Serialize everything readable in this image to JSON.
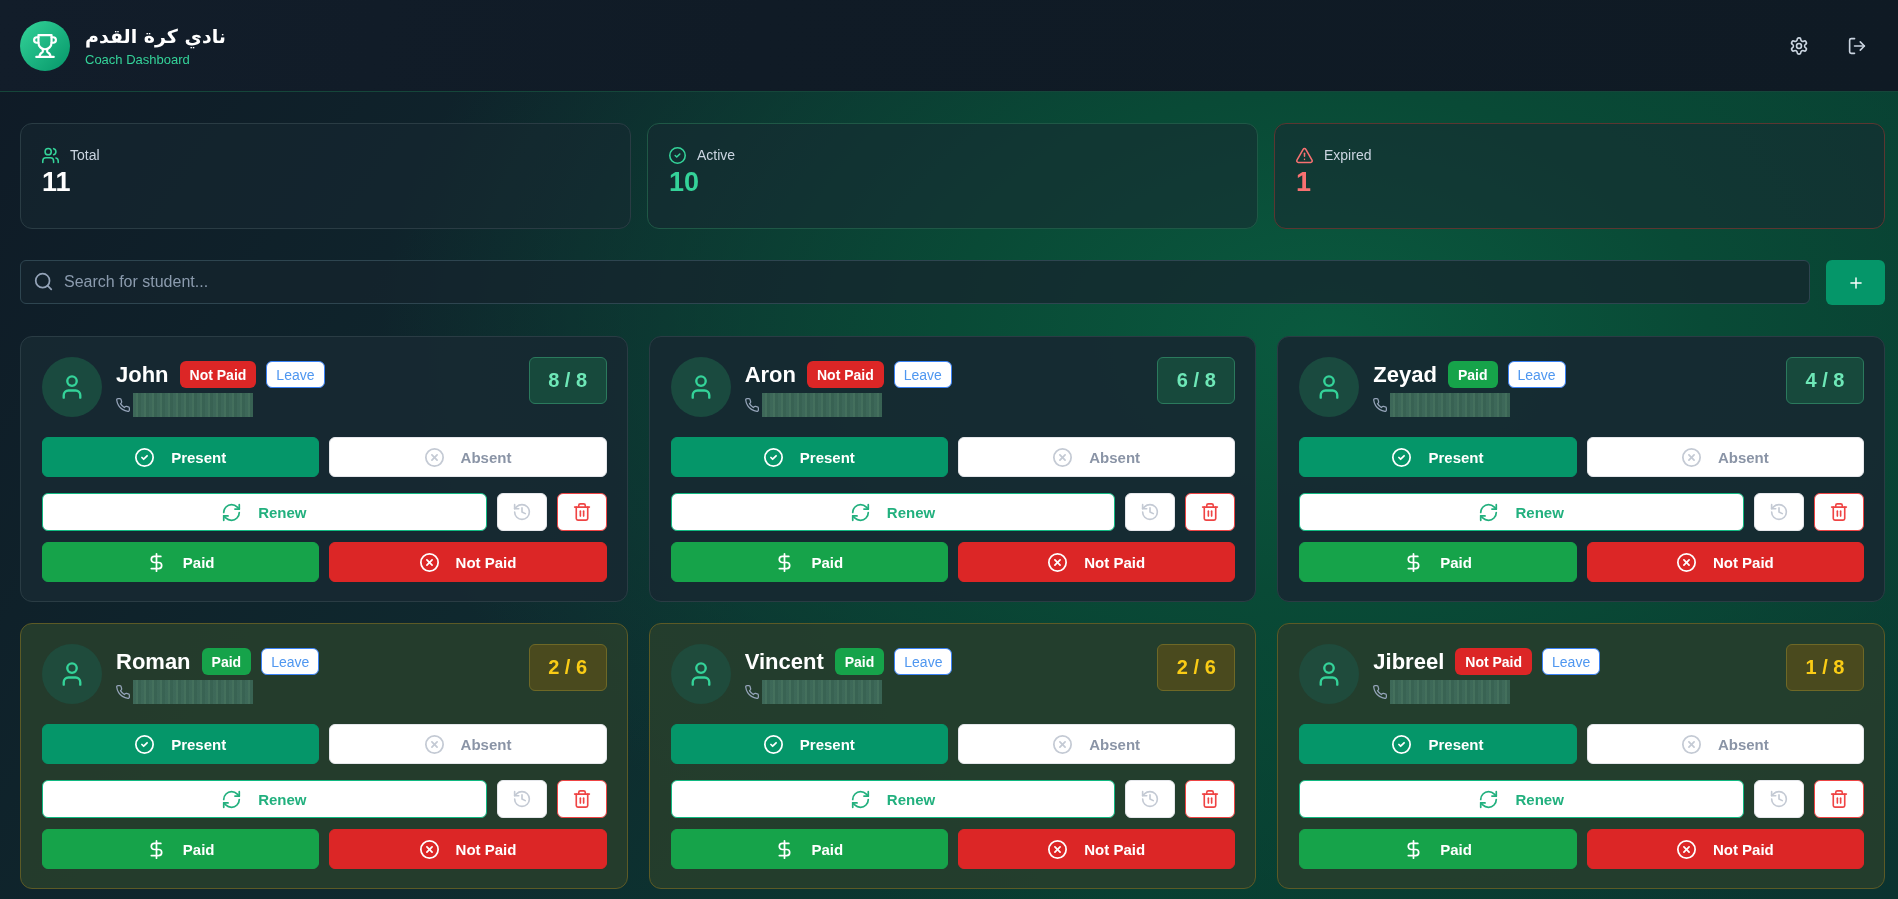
{
  "header": {
    "title": "نادي كرة القدم",
    "subtitle": "Coach Dashboard"
  },
  "stats": [
    {
      "kind": "total",
      "label": "Total",
      "value": "11"
    },
    {
      "kind": "active",
      "label": "Active",
      "value": "10"
    },
    {
      "kind": "expired",
      "label": "Expired",
      "value": "1"
    }
  ],
  "search": {
    "placeholder": "Search for student..."
  },
  "students": [
    {
      "name": "John",
      "status_badge": "Not Paid",
      "paid": false,
      "leave": "Leave",
      "sessions": "8 / 8",
      "low_sessions": false,
      "actions": [
        {
          "kind": "present",
          "label": "Present",
          "disabled": false
        },
        {
          "kind": "absent",
          "label": "Absent",
          "disabled": true
        },
        {
          "kind": "renew",
          "label": "Renew",
          "disabled": false
        },
        {
          "kind": "history",
          "disabled": true
        },
        {
          "kind": "delete",
          "disabled": false
        },
        {
          "kind": "paid",
          "label": "Paid",
          "disabled": false
        },
        {
          "kind": "not_paid",
          "label": "Not Paid",
          "disabled": false
        }
      ]
    },
    {
      "name": "Aron",
      "status_badge": "Not Paid",
      "paid": false,
      "leave": "Leave",
      "sessions": "6 / 8",
      "low_sessions": false,
      "actions": [
        {
          "kind": "present",
          "label": "Present",
          "disabled": false
        },
        {
          "kind": "absent",
          "label": "Absent",
          "disabled": true
        },
        {
          "kind": "renew",
          "label": "Renew",
          "disabled": false
        },
        {
          "kind": "history",
          "disabled": true
        },
        {
          "kind": "delete",
          "disabled": false
        },
        {
          "kind": "paid",
          "label": "Paid",
          "disabled": false
        },
        {
          "kind": "not_paid",
          "label": "Not Paid",
          "disabled": false
        }
      ]
    },
    {
      "name": "Zeyad",
      "status_badge": "Paid",
      "paid": true,
      "leave": "Leave",
      "sessions": "4 / 8",
      "low_sessions": false,
      "actions": [
        {
          "kind": "present",
          "label": "Present",
          "disabled": false
        },
        {
          "kind": "absent",
          "label": "Absent",
          "disabled": true
        },
        {
          "kind": "renew",
          "label": "Renew",
          "disabled": false
        },
        {
          "kind": "history",
          "disabled": true
        },
        {
          "kind": "delete",
          "disabled": false
        },
        {
          "kind": "paid",
          "label": "Paid",
          "disabled": false
        },
        {
          "kind": "not_paid",
          "label": "Not Paid",
          "disabled": false
        }
      ]
    },
    {
      "name": "Roman",
      "status_badge": "Paid",
      "paid": true,
      "leave": "Leave",
      "sessions": "2 / 6",
      "low_sessions": true,
      "actions": [
        {
          "kind": "present",
          "label": "Present",
          "disabled": false
        },
        {
          "kind": "absent",
          "label": "Absent",
          "disabled": true
        },
        {
          "kind": "renew",
          "label": "Renew",
          "disabled": false
        },
        {
          "kind": "history",
          "disabled": true
        },
        {
          "kind": "delete",
          "disabled": false
        },
        {
          "kind": "paid",
          "label": "Paid",
          "disabled": false
        },
        {
          "kind": "not_paid",
          "label": "Not Paid",
          "disabled": false
        }
      ]
    },
    {
      "name": "Vincent",
      "status_badge": "Paid",
      "paid": true,
      "leave": "Leave",
      "sessions": "2 / 6",
      "low_sessions": true,
      "actions": [
        {
          "kind": "present",
          "label": "Present",
          "disabled": false
        },
        {
          "kind": "absent",
          "label": "Absent",
          "disabled": true
        },
        {
          "kind": "renew",
          "label": "Renew",
          "disabled": false
        },
        {
          "kind": "history",
          "disabled": true
        },
        {
          "kind": "delete",
          "disabled": false
        },
        {
          "kind": "paid",
          "label": "Paid",
          "disabled": false
        },
        {
          "kind": "not_paid",
          "label": "Not Paid",
          "disabled": false
        }
      ]
    },
    {
      "name": "Jibreel",
      "status_badge": "Not Paid",
      "paid": false,
      "leave": "Leave",
      "sessions": "1 / 8",
      "low_sessions": true,
      "actions": [
        {
          "kind": "present",
          "label": "Present",
          "disabled": false
        },
        {
          "kind": "absent",
          "label": "Absent",
          "disabled": true
        },
        {
          "kind": "renew",
          "label": "Renew",
          "disabled": false
        },
        {
          "kind": "history",
          "disabled": true
        },
        {
          "kind": "delete",
          "disabled": false
        },
        {
          "kind": "paid",
          "label": "Paid",
          "disabled": false
        },
        {
          "kind": "not_paid",
          "label": "Not Paid",
          "disabled": false
        }
      ]
    }
  ]
}
